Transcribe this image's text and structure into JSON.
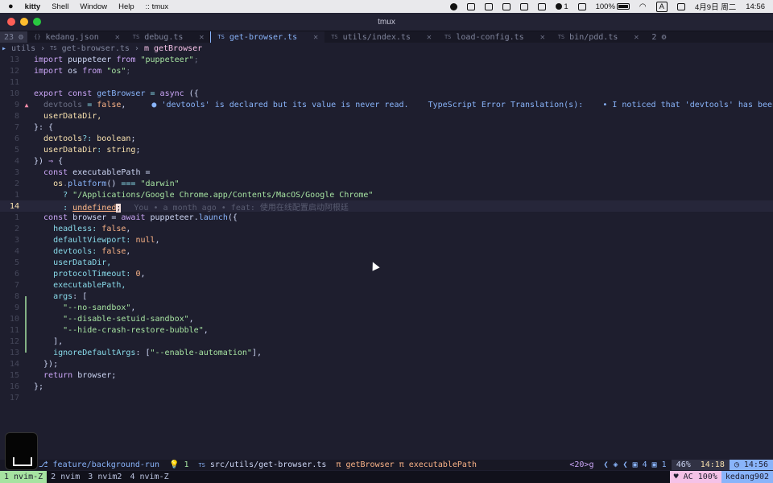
{
  "menubar": {
    "app": "kitty",
    "items": [
      "Shell",
      "Window",
      "Help",
      ":: tmux"
    ],
    "right": {
      "notif_count": "1",
      "battery": "100%",
      "input_method": "A",
      "date": "4月9日 周二",
      "time": "14:56"
    }
  },
  "window": {
    "title": "tmux"
  },
  "tabline": {
    "count": "23",
    "tabs": [
      {
        "icon": "{}",
        "name": "kedang.json"
      },
      {
        "icon": "TS",
        "name": "debug.ts"
      },
      {
        "icon": "TS",
        "name": "get-browser.ts"
      },
      {
        "icon": "TS",
        "name": "utils/index.ts"
      },
      {
        "icon": "TS",
        "name": "load-config.ts"
      },
      {
        "icon": "TS",
        "name": "bin/pdd.ts"
      }
    ],
    "close_glyph": "✕",
    "right_count": "2"
  },
  "breadcrumb": {
    "dir": "utils",
    "file": "get-browser.ts",
    "symbol": "getBrowser"
  },
  "editor": {
    "line_numbers": [
      "13",
      "12",
      "11",
      "10",
      "9",
      "8",
      "7",
      "6",
      "5",
      "4",
      "3",
      "2",
      "1",
      "14",
      "1",
      "2",
      "3",
      "4",
      "5",
      "6",
      "7",
      "8",
      "9",
      "10",
      "11",
      "12",
      "13",
      "14",
      "15",
      "16",
      "17"
    ],
    "diagnostic": "● 'devtools' is declared but its value is never read.    TypeScript Error Translation(s):    • I noticed that 'devtools' has been",
    "blame": "You • a month ago • feat: 使用在线配置启动阿根廷",
    "lines": {
      "l1a": "import",
      "l1b": " puppeteer ",
      "l1c": "from",
      "l1d": " \"puppeteer\"",
      "l1e": ";",
      "l2a": "import",
      "l2b": " os ",
      "l2c": "from",
      "l2d": " \"os\"",
      "l2e": ";",
      "l4a": "export const",
      "l4b": " getBrowser",
      "l4c": " = ",
      "l4d": "async",
      "l4e": " ({",
      "l5a": "  devtools",
      "l5b": " = ",
      "l5c": "false",
      "l5d": ",",
      "l6a": "  userDataDir,",
      "l7a": "}: {",
      "l8a": "  devtools",
      "l8b": "?: ",
      "l8c": "boolean",
      "l8d": ";",
      "l9a": "  userDataDir",
      "l9b": ": ",
      "l9c": "string",
      "l9d": ";",
      "l10a": "}) ",
      "l10b": "⇒",
      "l10c": " {",
      "l11a": "  const",
      "l11b": " executablePath =",
      "l12a": "    os",
      "l12b": ".",
      "l12c": "platform",
      "l12d": "() ",
      "l12e": "===",
      "l12f": " \"darwin\"",
      "l13a": "      ? ",
      "l13b": "\"/Applications/Google Chrome.app/Contents/MacOS/Google Chrome\"",
      "l14a": "      : ",
      "l14b": "undefined",
      "l14c": ";",
      "l15a": "  const",
      "l15b": " browser = ",
      "l15c": "await",
      "l15d": " puppeteer.",
      "l15e": "launch",
      "l15f": "({",
      "l16a": "    headless",
      "l16b": ": ",
      "l16c": "false",
      "l16d": ",",
      "l17a": "    defaultViewport",
      "l17b": ": ",
      "l17c": "null",
      "l17d": ",",
      "l18a": "    devtools",
      "l18b": ": ",
      "l18c": "false",
      "l18d": ",",
      "l19a": "    userDataDir,",
      "l20a": "    protocolTimeout",
      "l20b": ": ",
      "l20c": "0",
      "l20d": ",",
      "l21a": "    executablePath,",
      "l22a": "    args",
      "l22b": ": [",
      "l23a": "      \"--no-sandbox\"",
      "l23b": ",",
      "l24a": "      \"--disable-setuid-sandbox\"",
      "l24b": ",",
      "l25a": "      \"--hide-crash-restore-bubble\"",
      "l25b": ",",
      "l26a": "    ],",
      "l27a": "    ignoreDefaultArgs",
      "l27b": ": [",
      "l27c": "\"--enable-automation\"",
      "l27d": "],",
      "l28a": "  });",
      "l29a": "  return",
      "l29b": " browser;",
      "l30a": "};"
    }
  },
  "statusline": {
    "branch": "feature/background-run",
    "lsp": "1",
    "path": "src/utils/get-browser.ts",
    "pi1": "π getBrowser",
    "pi2": "π executablePath",
    "keys": "<20>g",
    "diag_info": "4",
    "diag_hint": "1",
    "percent": "46%",
    "position": "14:18",
    "time": "14:56"
  },
  "tmux": {
    "windows": [
      "1 nvim-Z",
      "2 nvim",
      "3 nvim2",
      "4 nvim-Z"
    ],
    "right": [
      "AC 100%",
      "kedang902"
    ]
  }
}
